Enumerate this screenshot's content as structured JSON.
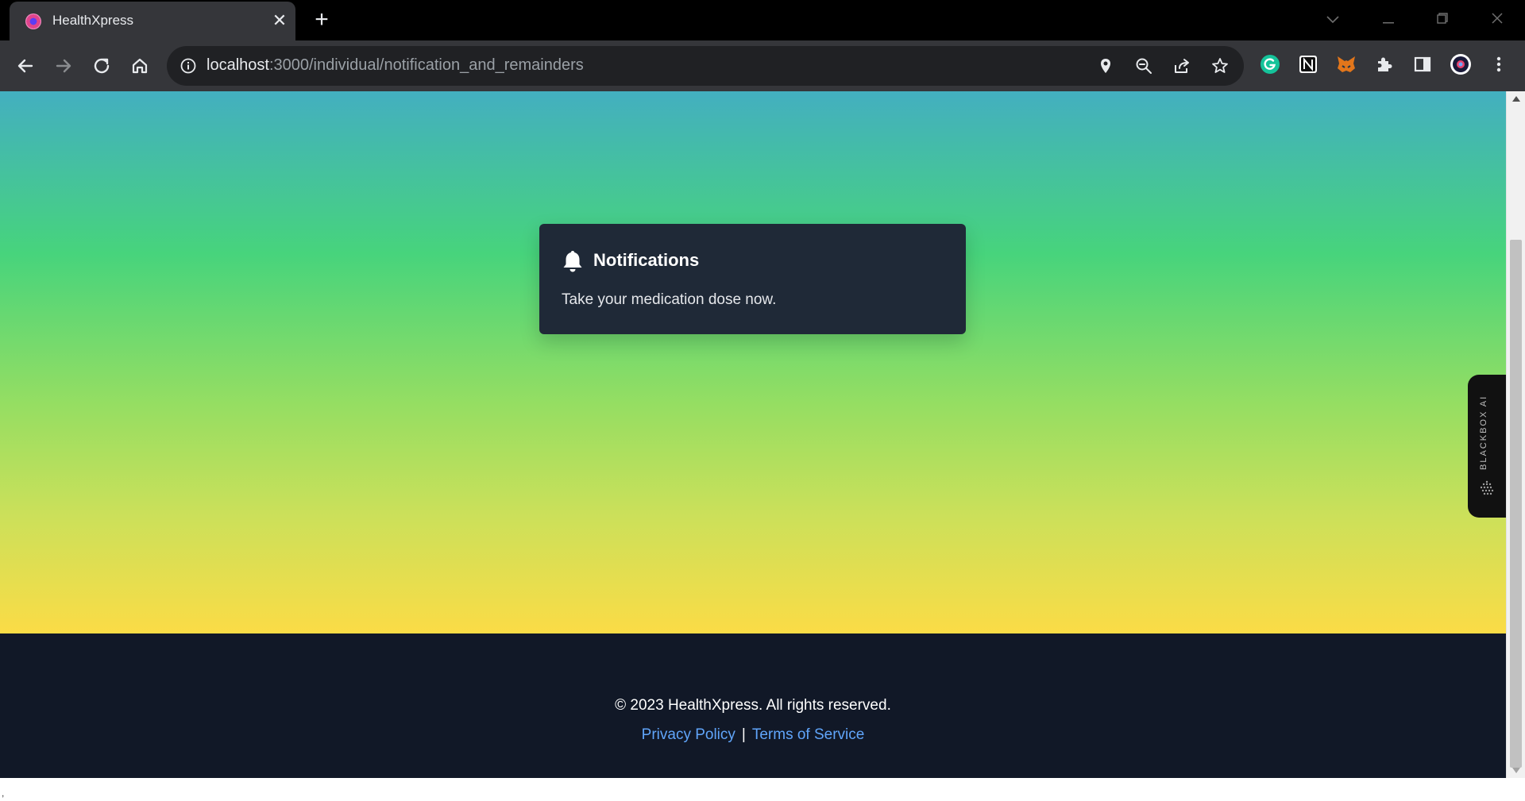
{
  "browser": {
    "tab_title": "HealthXpress",
    "url_host": "localhost",
    "url_rest": ":3000/individual/notification_and_remainders",
    "icons": [
      "back-icon",
      "forward-icon",
      "reload-icon",
      "home-icon",
      "info-icon",
      "location-icon",
      "zoom-out-icon",
      "share-icon",
      "star-icon",
      "grammarly-icon",
      "notion-icon",
      "metamask-icon",
      "extensions-icon",
      "sidepanel-icon",
      "profile-icon",
      "menu-icon"
    ]
  },
  "notification": {
    "title": "Notifications",
    "message": "Take your medication dose now."
  },
  "footer": {
    "copyright": "© 2023 HealthXpress. All rights reserved.",
    "privacy_label": "Privacy Policy",
    "separator": "|",
    "terms_label": "Terms of Service"
  },
  "blackbox": {
    "label": "BLACKBOX AI"
  },
  "bottom_strip": {
    "mark": ","
  },
  "colors": {
    "gradient_top": "#43afc0",
    "gradient_mid": "#47d47c",
    "gradient_bottom": "#fbdc46",
    "card_bg": "#1f2937",
    "footer_bg": "#111827",
    "link": "#60a5fa"
  }
}
